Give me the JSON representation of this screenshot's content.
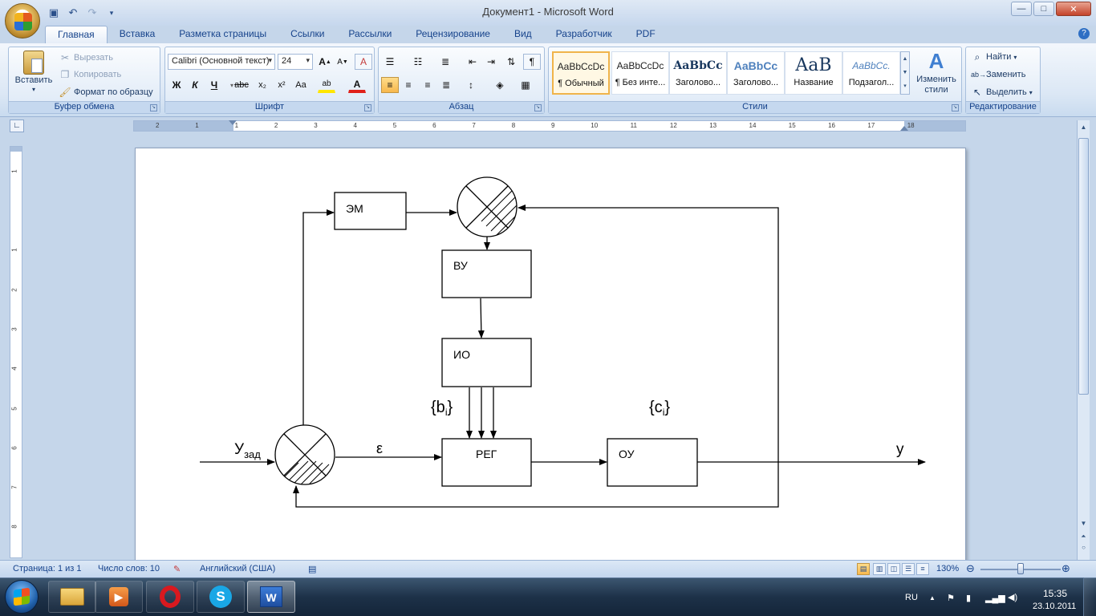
{
  "window": {
    "title": "Документ1 - Microsoft Word",
    "controls": {
      "minimize": "—",
      "maximize": "□",
      "close": "✕"
    }
  },
  "quick_access": [
    "save-icon",
    "undo-icon",
    "redo-icon",
    "customize-icon"
  ],
  "tabs": [
    {
      "label": "Главная",
      "active": true
    },
    {
      "label": "Вставка"
    },
    {
      "label": "Разметка страницы"
    },
    {
      "label": "Ссылки"
    },
    {
      "label": "Рассылки"
    },
    {
      "label": "Рецензирование"
    },
    {
      "label": "Вид"
    },
    {
      "label": "Разработчик"
    },
    {
      "label": "PDF"
    }
  ],
  "ribbon": {
    "clipboard": {
      "label": "Буфер обмена",
      "paste": "Вставить",
      "cut": "Вырезать",
      "copy": "Копировать",
      "format_painter": "Формат по образцу"
    },
    "font": {
      "label": "Шрифт",
      "font_name": "Calibri (Основной текст)",
      "font_size": "24",
      "bold": "Ж",
      "italic": "К",
      "underline": "Ч",
      "strike": "abc",
      "subscript": "x₂",
      "superscript": "x²",
      "case": "Aa",
      "grow": "A",
      "shrink": "A",
      "highlight": "ab",
      "font_color": "A",
      "clear": "A"
    },
    "paragraph": {
      "label": "Абзац",
      "pilcrow": "¶"
    },
    "styles": {
      "label": "Стили",
      "items": [
        {
          "sample": "AaBbCcDc",
          "name": "¶ Обычный",
          "selected": true
        },
        {
          "sample": "AaBbCcDc",
          "name": "¶ Без инте..."
        },
        {
          "sample": "AaBbCc",
          "name": "Заголово..."
        },
        {
          "sample": "AaBbCc",
          "name": "Заголово..."
        },
        {
          "sample": "AaB",
          "name": "Название"
        },
        {
          "sample": "AaBbCc.",
          "name": "Подзагол..."
        }
      ],
      "change_styles": "Изменить стили"
    },
    "editing": {
      "label": "Редактирование",
      "find": "Найти",
      "replace": "Заменить",
      "select": "Выделить"
    }
  },
  "rulers": {
    "horizontal": [
      "2",
      "1",
      "1",
      "2",
      "3",
      "4",
      "5",
      "6",
      "7",
      "8",
      "9",
      "10",
      "11",
      "12",
      "13",
      "14",
      "15",
      "16",
      "17",
      "18"
    ],
    "vertical": [
      "1",
      "1",
      "2",
      "3",
      "4",
      "5",
      "6",
      "7",
      "8"
    ]
  },
  "diagram": {
    "blocks": {
      "em": "ЭМ",
      "vu": "ВУ",
      "io": "ИО",
      "reg": "РЕГ",
      "ou": "ОУ"
    },
    "labels": {
      "y_zad_main": "У",
      "y_zad_sub": "зад",
      "epsilon": "ε",
      "bi_open": "{b",
      "bi_sub": "i",
      "bi_close": "}",
      "ci_open": "{c",
      "ci_sub": "i",
      "ci_close": "}",
      "output": "у"
    }
  },
  "status": {
    "page": "Страница: 1 из 1",
    "words": "Число слов: 10",
    "language": "Английский (США)",
    "zoom": "130%"
  },
  "taskbar": {
    "apps": [
      "explorer-icon",
      "media-player-icon",
      "opera-icon",
      "skype-icon",
      "word-icon"
    ],
    "lang": "RU",
    "time": "15:35",
    "date": "23.10.2011"
  }
}
